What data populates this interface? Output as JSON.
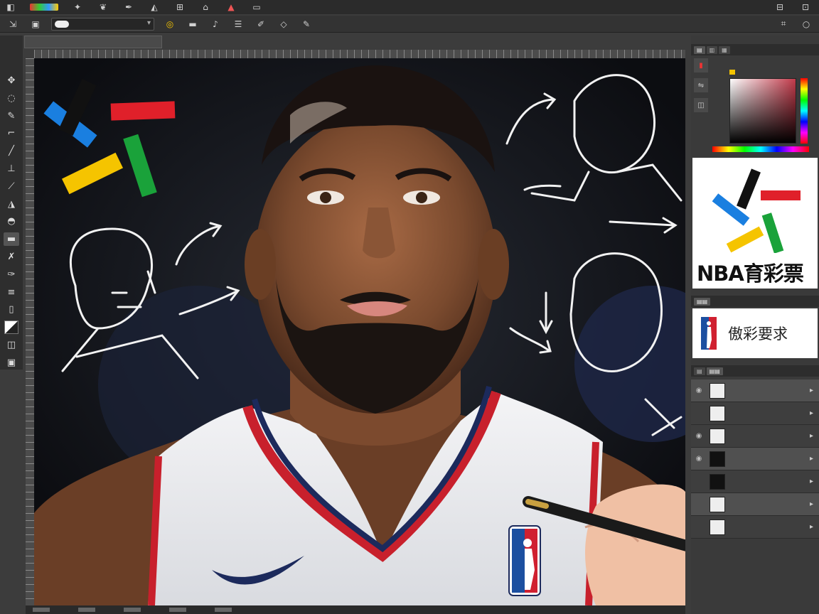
{
  "menubar": {
    "items": [
      "ps-logo-icon",
      "color-swatch",
      "brush-icon",
      "pen-icon",
      "erase-icon",
      "grid-icon",
      "home-icon",
      "rainbow-icon",
      "layers-icon"
    ]
  },
  "optbar": {
    "preset": ""
  },
  "document": {
    "tab_label": ""
  },
  "tools": [
    "move-icon",
    "lasso-icon",
    "brush-icon",
    "stamp-icon",
    "pencil-icon",
    "path-icon",
    "pen-icon",
    "type-icon",
    "shape-icon",
    "eyedropper-icon",
    "dodge-icon",
    "hand-icon"
  ],
  "panels": {
    "logo_text": "NBA育彩票",
    "requirement_text": "傲彩要求"
  },
  "layers": [
    {
      "name": "",
      "thumb": "brush-mark"
    },
    {
      "name": "",
      "thumb": "outline"
    },
    {
      "name": "",
      "thumb": "symbol"
    },
    {
      "name": "",
      "thumb": "black"
    },
    {
      "name": "",
      "thumb": "black"
    },
    {
      "name": "",
      "thumb": "blank"
    },
    {
      "name": "",
      "thumb": "blank"
    }
  ],
  "colors": {
    "blue": "#1a7fe0",
    "black": "#111111",
    "red": "#e0202a",
    "yellow": "#f5c400",
    "green": "#1aa23a",
    "jersey_red": "#c8202c",
    "jersey_navy": "#1c2a5c"
  }
}
